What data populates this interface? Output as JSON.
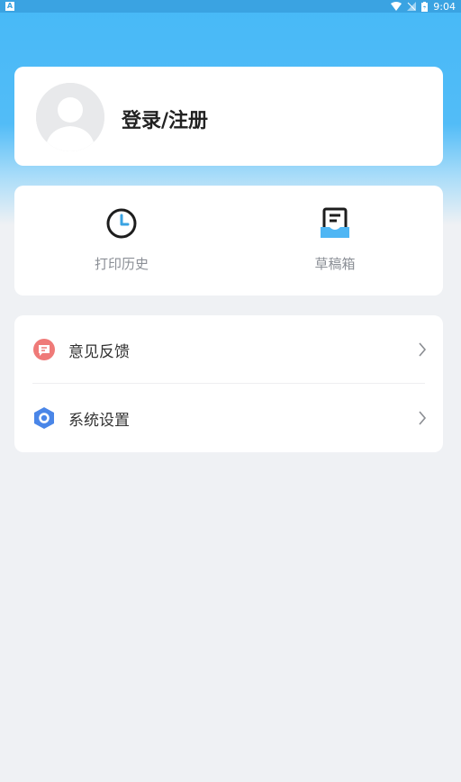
{
  "status_bar": {
    "notification_letter": "A",
    "time": "9:04"
  },
  "profile": {
    "login_label": "登录/注册"
  },
  "quick_actions": [
    {
      "label": "打印历史",
      "icon": "clock-icon"
    },
    {
      "label": "草稿箱",
      "icon": "draft-box-icon"
    }
  ],
  "menu": [
    {
      "label": "意见反馈",
      "icon": "feedback-icon",
      "color": "#e8615f"
    },
    {
      "label": "系统设置",
      "icon": "settings-hexagon-icon",
      "color": "#3f7ee3"
    }
  ],
  "colors": {
    "header_blue": "#47b9f7",
    "page_background": "#eff1f4"
  }
}
